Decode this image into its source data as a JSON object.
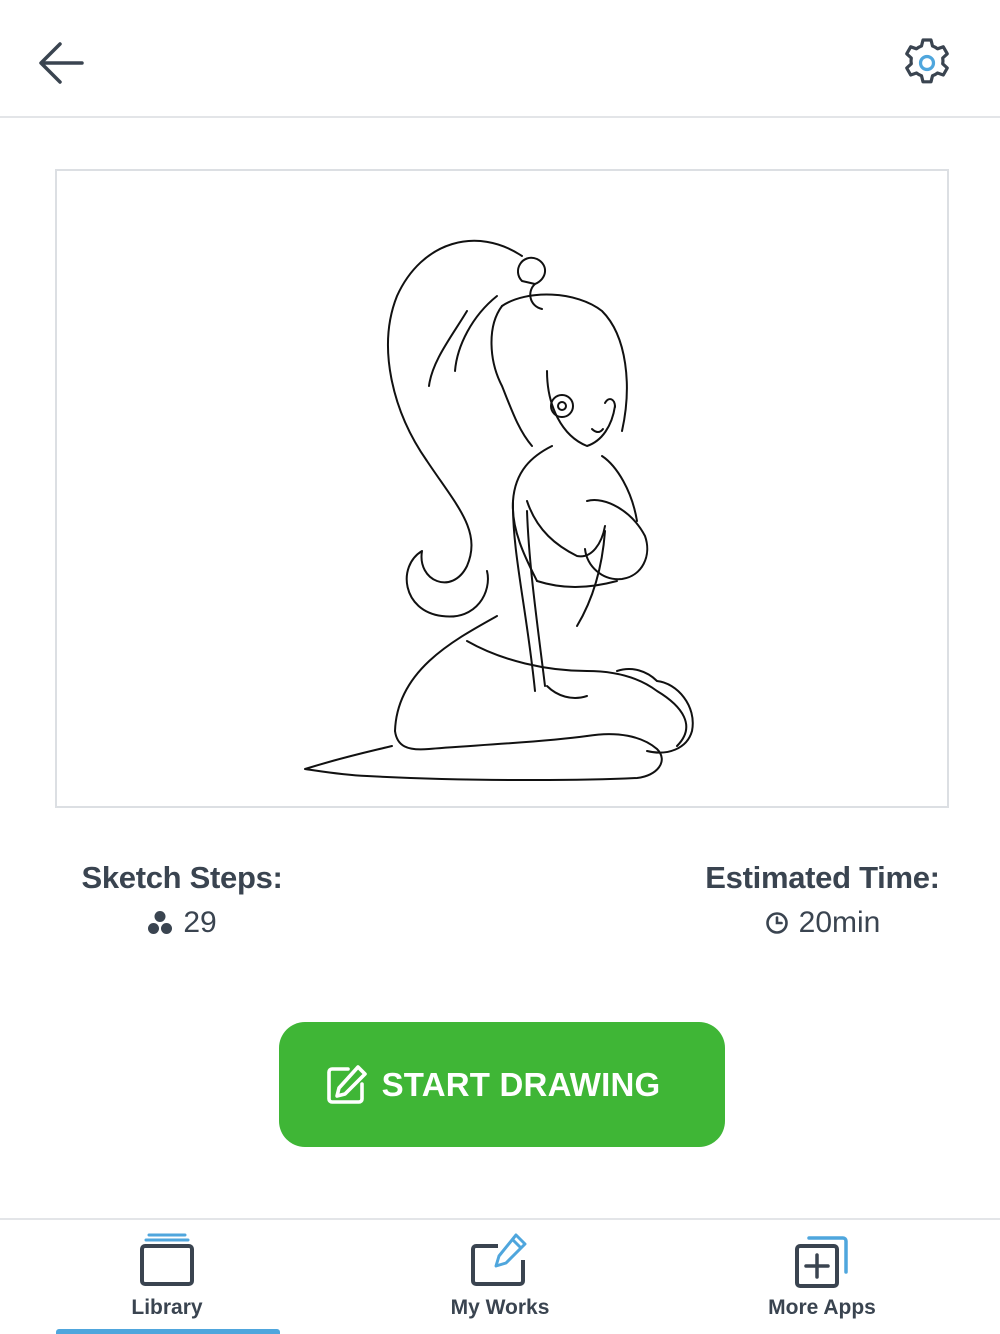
{
  "header": {
    "back_icon": "arrow-left-icon",
    "settings_icon": "gear-icon"
  },
  "preview": {
    "image_icon": "sketch-preview-girl"
  },
  "info": {
    "steps_label": "Sketch Steps:",
    "steps_value": "29",
    "steps_icon": "steps-cluster-icon",
    "time_label": "Estimated Time:",
    "time_value": "20min",
    "time_icon": "clock-icon"
  },
  "start_button": {
    "label": "START DRAWING",
    "icon": "edit-icon",
    "color": "#3fb636"
  },
  "bottom_nav": {
    "items": [
      {
        "label": "Library",
        "icon": "library-stack-icon",
        "active": true
      },
      {
        "label": "My Works",
        "icon": "pencil-board-icon",
        "active": false
      },
      {
        "label": "More Apps",
        "icon": "add-square-icon",
        "active": false
      }
    ],
    "active_color": "#4fa6dd"
  },
  "colors": {
    "text": "#3a4450",
    "divider": "#e3e5e8",
    "accent_blue": "#4fa6dd"
  }
}
